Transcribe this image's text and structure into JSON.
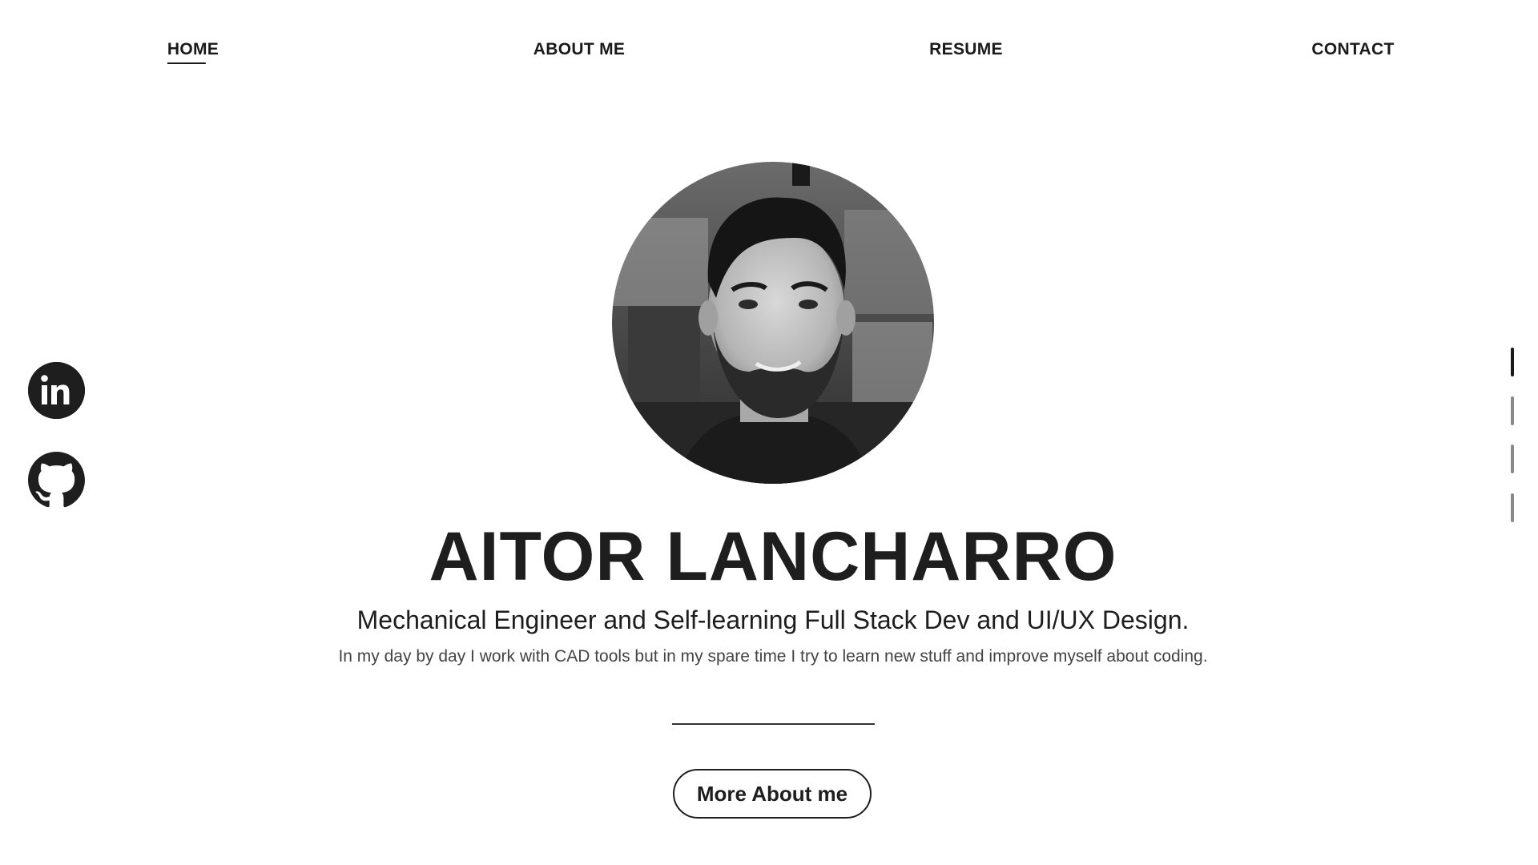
{
  "nav": {
    "items": [
      {
        "label": "HOME",
        "active": true
      },
      {
        "label": "ABOUT ME",
        "active": false
      },
      {
        "label": "RESUME",
        "active": false
      },
      {
        "label": "CONTACT",
        "active": false
      }
    ]
  },
  "social": {
    "linkedin_icon": "linkedin-icon",
    "github_icon": "github-icon"
  },
  "section_indicators": {
    "count": 4,
    "active_index": 0
  },
  "hero": {
    "name": "AITOR LANCHARRO",
    "subtitle": "Mechanical Engineer and Self-learning Full Stack Dev and UI/UX Design.",
    "description": "In my day by day I work with CAD tools but in my spare time I try to learn new stuff and improve myself about coding.",
    "button_label": "More About me"
  },
  "colors": {
    "text": "#1e1e1e",
    "background": "#ffffff",
    "muted": "#8a8a8a"
  }
}
